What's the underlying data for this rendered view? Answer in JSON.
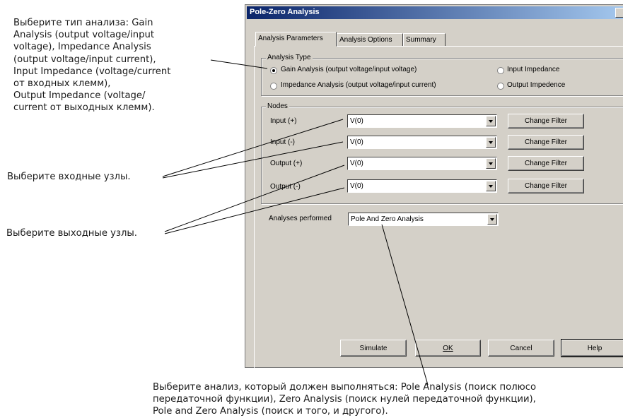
{
  "annotations": {
    "type_lines": [
      "Выберите тип анализа: Gain",
      "Analysis (output voltage/input",
      "voltage), Impedance Analysis",
      "(output voltage/input current),",
      "Input Impedance (voltage/current",
      "от входных клемм),",
      "Output Impedance (voltage/",
      "current от выходных клемм)."
    ],
    "input_nodes": "Выберите входные узлы.",
    "output_nodes": "Выберите выходные узлы.",
    "analysis_lines": [
      "Выберите анализ, который должен выполняться: Pole Analysis (поиск полюсо",
      "передаточной функции), Zero Analysis (поиск нулей передаточной функции),",
      "Pole and Zero Analysis (поиск и того, и другого)."
    ]
  },
  "dialog": {
    "title": "Pole-Zero Analysis",
    "tabs": [
      "Analysis Parameters",
      "Analysis Options",
      "Summary"
    ],
    "analysis_type": {
      "label": "Analysis Type",
      "options": [
        "Gain Analysis (output voltage/input voltage)",
        "Input Impedance",
        "Impedance Analysis (output voltage/input current)",
        "Output Impedence"
      ],
      "selected": "Gain Analysis (output voltage/input voltage)"
    },
    "nodes": {
      "label": "Nodes",
      "rows": [
        {
          "label": "Input (+)",
          "value": "V(0)",
          "button": "Change Filter"
        },
        {
          "label": "Input (-)",
          "value": "V(0)",
          "button": "Change Filter"
        },
        {
          "label": "Output (+)",
          "value": "V(0)",
          "button": "Change Filter"
        },
        {
          "label": "Output (-)",
          "value": "V(0)",
          "button": "Change Filter"
        }
      ]
    },
    "analyses_performed": {
      "label": "Analyses performed",
      "value": "Pole And Zero Analysis"
    },
    "buttons": {
      "simulate": "Simulate",
      "ok": "OK",
      "cancel": "Cancel",
      "help": "Help"
    }
  }
}
